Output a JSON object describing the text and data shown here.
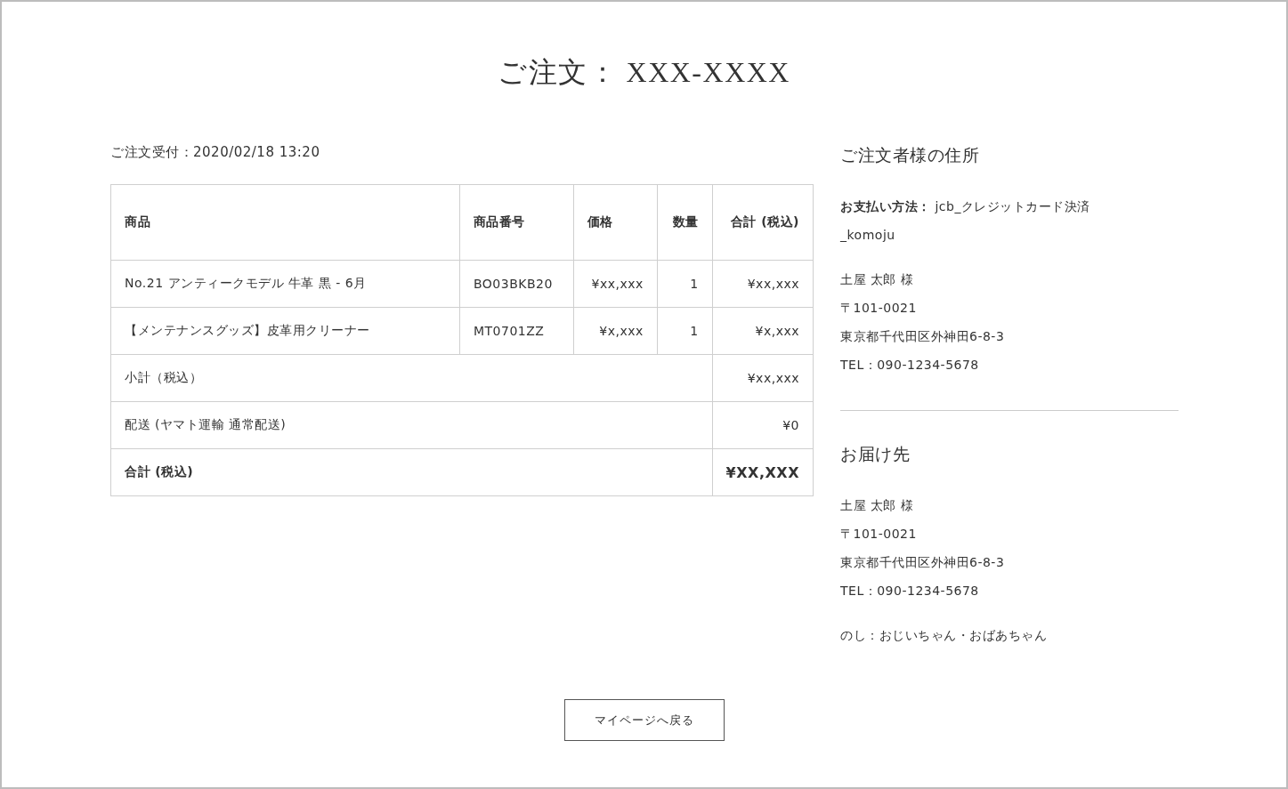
{
  "title": "ご注文： XXX-XXXX",
  "order_date": "ご注文受付：2020/02/18 13:20",
  "table": {
    "columns": [
      "商品",
      "商品番号",
      "価格",
      "数量",
      "合計 (税込)"
    ],
    "rows": [
      {
        "cells": [
          "No.21 アンティークモデル 牛革 黒 - 6月",
          "BO03BKB20",
          "¥xx,xxx",
          "1",
          "¥xx,xxx"
        ]
      },
      {
        "cells": [
          "【メンテナンスグッズ】皮革用クリーナー",
          "MT0701ZZ",
          "¥x,xxx",
          "1",
          "¥x,xxx"
        ]
      }
    ],
    "summary": [
      {
        "kind": "normal",
        "label": "小計（税込）",
        "value": "¥xx,xxx"
      },
      {
        "kind": "normal",
        "label": "配送 (ヤマト運輸 通常配送)",
        "value": "¥0"
      },
      {
        "kind": "total",
        "label": "合計 (税込)",
        "value": "¥XX,XXX"
      }
    ]
  },
  "orderer": {
    "heading": "ご注文者様の住所",
    "payment": "**お支払い方法：** jcb_クレジットカード決済_komoju",
    "lines": [
      "土屋 太郎 様",
      "〒101-0021",
      "東京都千代田区外神田6-8-3",
      "TEL：090-1234-5678"
    ]
  },
  "delivery": {
    "heading": "お届け先",
    "lines": [
      "土屋 太郎 様",
      "〒101-0021",
      "東京都千代田区外神田6-8-3",
      "TEL：090-1234-5678"
    ],
    "note": "のし：おじいちゃん・おばあちゃん"
  },
  "back_button": "マイページへ戻る"
}
